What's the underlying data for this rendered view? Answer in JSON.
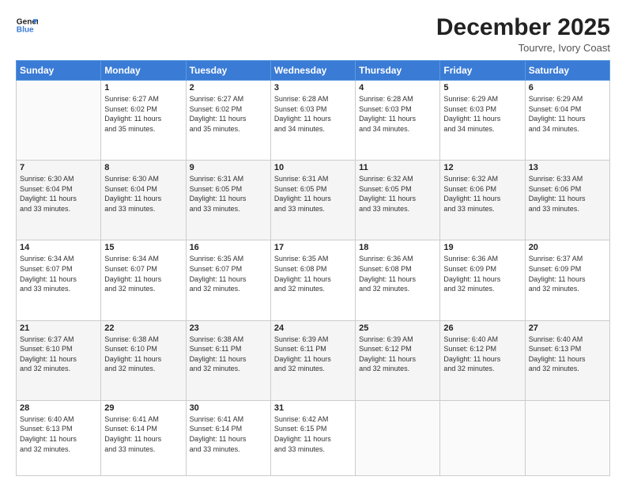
{
  "header": {
    "logo_line1": "General",
    "logo_line2": "Blue",
    "month": "December 2025",
    "location": "Tourvre, Ivory Coast"
  },
  "weekdays": [
    "Sunday",
    "Monday",
    "Tuesday",
    "Wednesday",
    "Thursday",
    "Friday",
    "Saturday"
  ],
  "weeks": [
    [
      {
        "day": "",
        "text": ""
      },
      {
        "day": "1",
        "text": "Sunrise: 6:27 AM\nSunset: 6:02 PM\nDaylight: 11 hours\nand 35 minutes."
      },
      {
        "day": "2",
        "text": "Sunrise: 6:27 AM\nSunset: 6:02 PM\nDaylight: 11 hours\nand 35 minutes."
      },
      {
        "day": "3",
        "text": "Sunrise: 6:28 AM\nSunset: 6:03 PM\nDaylight: 11 hours\nand 34 minutes."
      },
      {
        "day": "4",
        "text": "Sunrise: 6:28 AM\nSunset: 6:03 PM\nDaylight: 11 hours\nand 34 minutes."
      },
      {
        "day": "5",
        "text": "Sunrise: 6:29 AM\nSunset: 6:03 PM\nDaylight: 11 hours\nand 34 minutes."
      },
      {
        "day": "6",
        "text": "Sunrise: 6:29 AM\nSunset: 6:04 PM\nDaylight: 11 hours\nand 34 minutes."
      }
    ],
    [
      {
        "day": "7",
        "text": "Sunrise: 6:30 AM\nSunset: 6:04 PM\nDaylight: 11 hours\nand 33 minutes."
      },
      {
        "day": "8",
        "text": "Sunrise: 6:30 AM\nSunset: 6:04 PM\nDaylight: 11 hours\nand 33 minutes."
      },
      {
        "day": "9",
        "text": "Sunrise: 6:31 AM\nSunset: 6:05 PM\nDaylight: 11 hours\nand 33 minutes."
      },
      {
        "day": "10",
        "text": "Sunrise: 6:31 AM\nSunset: 6:05 PM\nDaylight: 11 hours\nand 33 minutes."
      },
      {
        "day": "11",
        "text": "Sunrise: 6:32 AM\nSunset: 6:05 PM\nDaylight: 11 hours\nand 33 minutes."
      },
      {
        "day": "12",
        "text": "Sunrise: 6:32 AM\nSunset: 6:06 PM\nDaylight: 11 hours\nand 33 minutes."
      },
      {
        "day": "13",
        "text": "Sunrise: 6:33 AM\nSunset: 6:06 PM\nDaylight: 11 hours\nand 33 minutes."
      }
    ],
    [
      {
        "day": "14",
        "text": "Sunrise: 6:34 AM\nSunset: 6:07 PM\nDaylight: 11 hours\nand 33 minutes."
      },
      {
        "day": "15",
        "text": "Sunrise: 6:34 AM\nSunset: 6:07 PM\nDaylight: 11 hours\nand 32 minutes."
      },
      {
        "day": "16",
        "text": "Sunrise: 6:35 AM\nSunset: 6:07 PM\nDaylight: 11 hours\nand 32 minutes."
      },
      {
        "day": "17",
        "text": "Sunrise: 6:35 AM\nSunset: 6:08 PM\nDaylight: 11 hours\nand 32 minutes."
      },
      {
        "day": "18",
        "text": "Sunrise: 6:36 AM\nSunset: 6:08 PM\nDaylight: 11 hours\nand 32 minutes."
      },
      {
        "day": "19",
        "text": "Sunrise: 6:36 AM\nSunset: 6:09 PM\nDaylight: 11 hours\nand 32 minutes."
      },
      {
        "day": "20",
        "text": "Sunrise: 6:37 AM\nSunset: 6:09 PM\nDaylight: 11 hours\nand 32 minutes."
      }
    ],
    [
      {
        "day": "21",
        "text": "Sunrise: 6:37 AM\nSunset: 6:10 PM\nDaylight: 11 hours\nand 32 minutes."
      },
      {
        "day": "22",
        "text": "Sunrise: 6:38 AM\nSunset: 6:10 PM\nDaylight: 11 hours\nand 32 minutes."
      },
      {
        "day": "23",
        "text": "Sunrise: 6:38 AM\nSunset: 6:11 PM\nDaylight: 11 hours\nand 32 minutes."
      },
      {
        "day": "24",
        "text": "Sunrise: 6:39 AM\nSunset: 6:11 PM\nDaylight: 11 hours\nand 32 minutes."
      },
      {
        "day": "25",
        "text": "Sunrise: 6:39 AM\nSunset: 6:12 PM\nDaylight: 11 hours\nand 32 minutes."
      },
      {
        "day": "26",
        "text": "Sunrise: 6:40 AM\nSunset: 6:12 PM\nDaylight: 11 hours\nand 32 minutes."
      },
      {
        "day": "27",
        "text": "Sunrise: 6:40 AM\nSunset: 6:13 PM\nDaylight: 11 hours\nand 32 minutes."
      }
    ],
    [
      {
        "day": "28",
        "text": "Sunrise: 6:40 AM\nSunset: 6:13 PM\nDaylight: 11 hours\nand 32 minutes."
      },
      {
        "day": "29",
        "text": "Sunrise: 6:41 AM\nSunset: 6:14 PM\nDaylight: 11 hours\nand 33 minutes."
      },
      {
        "day": "30",
        "text": "Sunrise: 6:41 AM\nSunset: 6:14 PM\nDaylight: 11 hours\nand 33 minutes."
      },
      {
        "day": "31",
        "text": "Sunrise: 6:42 AM\nSunset: 6:15 PM\nDaylight: 11 hours\nand 33 minutes."
      },
      {
        "day": "",
        "text": ""
      },
      {
        "day": "",
        "text": ""
      },
      {
        "day": "",
        "text": ""
      }
    ]
  ]
}
